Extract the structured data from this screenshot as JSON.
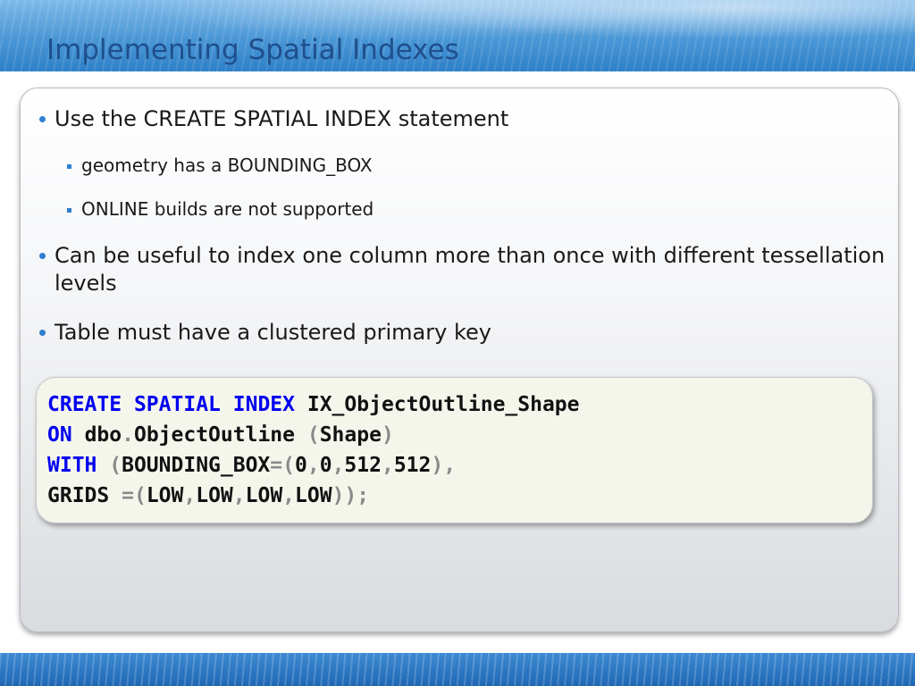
{
  "slide": {
    "title": "Implementing Spatial Indexes"
  },
  "bullets": {
    "b1": "Use the CREATE SPATIAL INDEX statement",
    "b1_sub1": "geometry has a BOUNDING_BOX",
    "b1_sub2": "ONLINE builds are not supported",
    "b2": "Can be useful to index one column more than once with different tessellation levels",
    "b3": "Table must have a clustered primary key"
  },
  "code": {
    "l1_kw1": "CREATE",
    "l1_kw2": "SPATIAL",
    "l1_kw3": "INDEX",
    "l1_name": "IX_ObjectOutline_Shape",
    "l2_kw": "ON",
    "l2_schema": "dbo",
    "l2_dot": ".",
    "l2_table": "ObjectOutline",
    "l2_open": "(",
    "l2_col": "Shape",
    "l2_close": ")",
    "l3_kw": "WITH",
    "l3_open": "(",
    "l3_opt": "BOUNDING_BOX",
    "l3_eq": "=(",
    "l3_v1": "0",
    "l3_c1": ",",
    "l3_v2": "0",
    "l3_c2": ",",
    "l3_v3": "512",
    "l3_c3": ",",
    "l3_v4": "512",
    "l3_end": "),",
    "l4_opt": "GRIDS",
    "l4_eq": "=(",
    "l4_g1": "LOW",
    "l4_c1": ",",
    "l4_g2": "LOW",
    "l4_c2": ",",
    "l4_g3": "LOW",
    "l4_c3": ",",
    "l4_g4": "LOW",
    "l4_end": "));"
  },
  "colors": {
    "title": "#1f4f8c",
    "bullet_marker": "#2e7fd0",
    "keyword": "#0000ee",
    "punctuation": "#8a8a8a",
    "code_background": "#f4f6ec"
  }
}
